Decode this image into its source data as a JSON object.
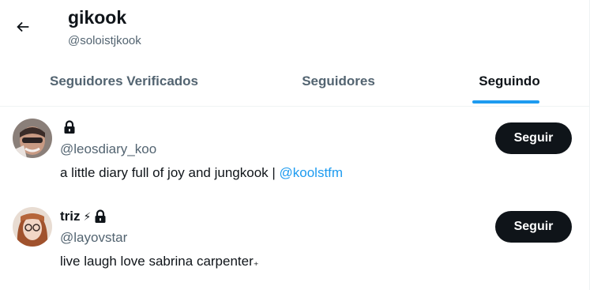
{
  "header": {
    "title": "gikook",
    "handle": "@soloistjkook",
    "back_icon": "arrow-left-icon"
  },
  "tabs": [
    {
      "label": "Seguidores Verificados",
      "active": false
    },
    {
      "label": "Seguidores",
      "active": false
    },
    {
      "label": "Seguindo",
      "active": true
    }
  ],
  "users": [
    {
      "name": "",
      "protected": true,
      "handle": "@leosdiary_koo",
      "bio_text": "a little diary full of joy and jungkook | ",
      "bio_mention": "@koolstfm",
      "follow_label": "Seguir"
    },
    {
      "name": "triz",
      "name_emoji": "⚡",
      "protected": true,
      "handle": "@layovstar",
      "bio_text": "live laugh love sabrina carpenter",
      "bio_trailing": "₊",
      "follow_label": "Seguir"
    }
  ],
  "colors": {
    "accent": "#1d9bf0",
    "text_primary": "#0f1419",
    "text_secondary": "#536471",
    "button_bg": "#0f1419"
  }
}
